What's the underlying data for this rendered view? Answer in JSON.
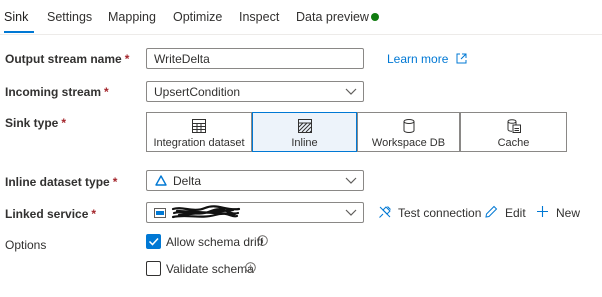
{
  "tabs": [
    {
      "label": "Sink",
      "active": true
    },
    {
      "label": "Settings"
    },
    {
      "label": "Mapping"
    },
    {
      "label": "Optimize"
    },
    {
      "label": "Inspect"
    },
    {
      "label": "Data preview"
    }
  ],
  "data_preview_status_color": "#107c10",
  "required_marker": "*",
  "output_stream": {
    "label": "Output stream name",
    "value": "WriteDelta"
  },
  "learn_more": "Learn more",
  "incoming_stream": {
    "label": "Incoming stream",
    "value": "UpsertCondition"
  },
  "sink_type": {
    "label": "Sink type",
    "options": [
      {
        "label": "Integration dataset",
        "icon": "table-icon"
      },
      {
        "label": "Inline",
        "icon": "inline-dataset-icon",
        "selected": true
      },
      {
        "label": "Workspace DB",
        "icon": "database-icon"
      },
      {
        "label": "Cache",
        "icon": "cache-icon"
      }
    ]
  },
  "inline_dataset_type": {
    "label": "Inline dataset type",
    "value": "Delta",
    "icon": "delta-icon"
  },
  "linked_service": {
    "label": "Linked service",
    "value_redacted": true,
    "icon": "storage-icon"
  },
  "actions": {
    "test_connection": "Test connection",
    "edit": "Edit",
    "new": "New"
  },
  "options": {
    "label": "Options",
    "allow_schema_drift": {
      "label": "Allow schema drift",
      "checked": true
    },
    "validate_schema": {
      "label": "Validate schema",
      "checked": false
    }
  },
  "colors": {
    "accent": "#0078d4",
    "required": "#a4262c",
    "selected_bg": "#edf3fa"
  }
}
